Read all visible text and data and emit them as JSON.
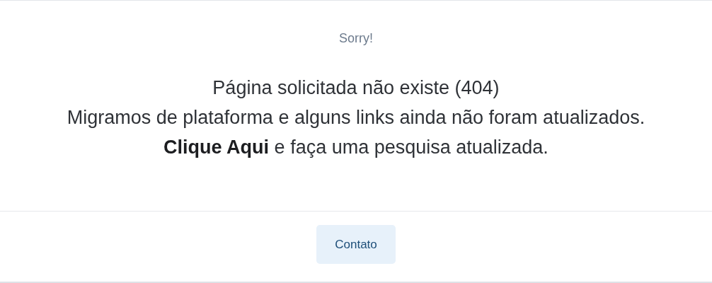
{
  "header": {
    "text": "Sorry!"
  },
  "message": [
    "Página solicitada não existe (404)",
    "Migramos de plataforma e alguns links ainda não foram atualizados.",
    "**Clique Aqui** e faça uma pesquisa atualizada."
  ],
  "buttons": [
    {
      "label": "Contato"
    }
  ]
}
